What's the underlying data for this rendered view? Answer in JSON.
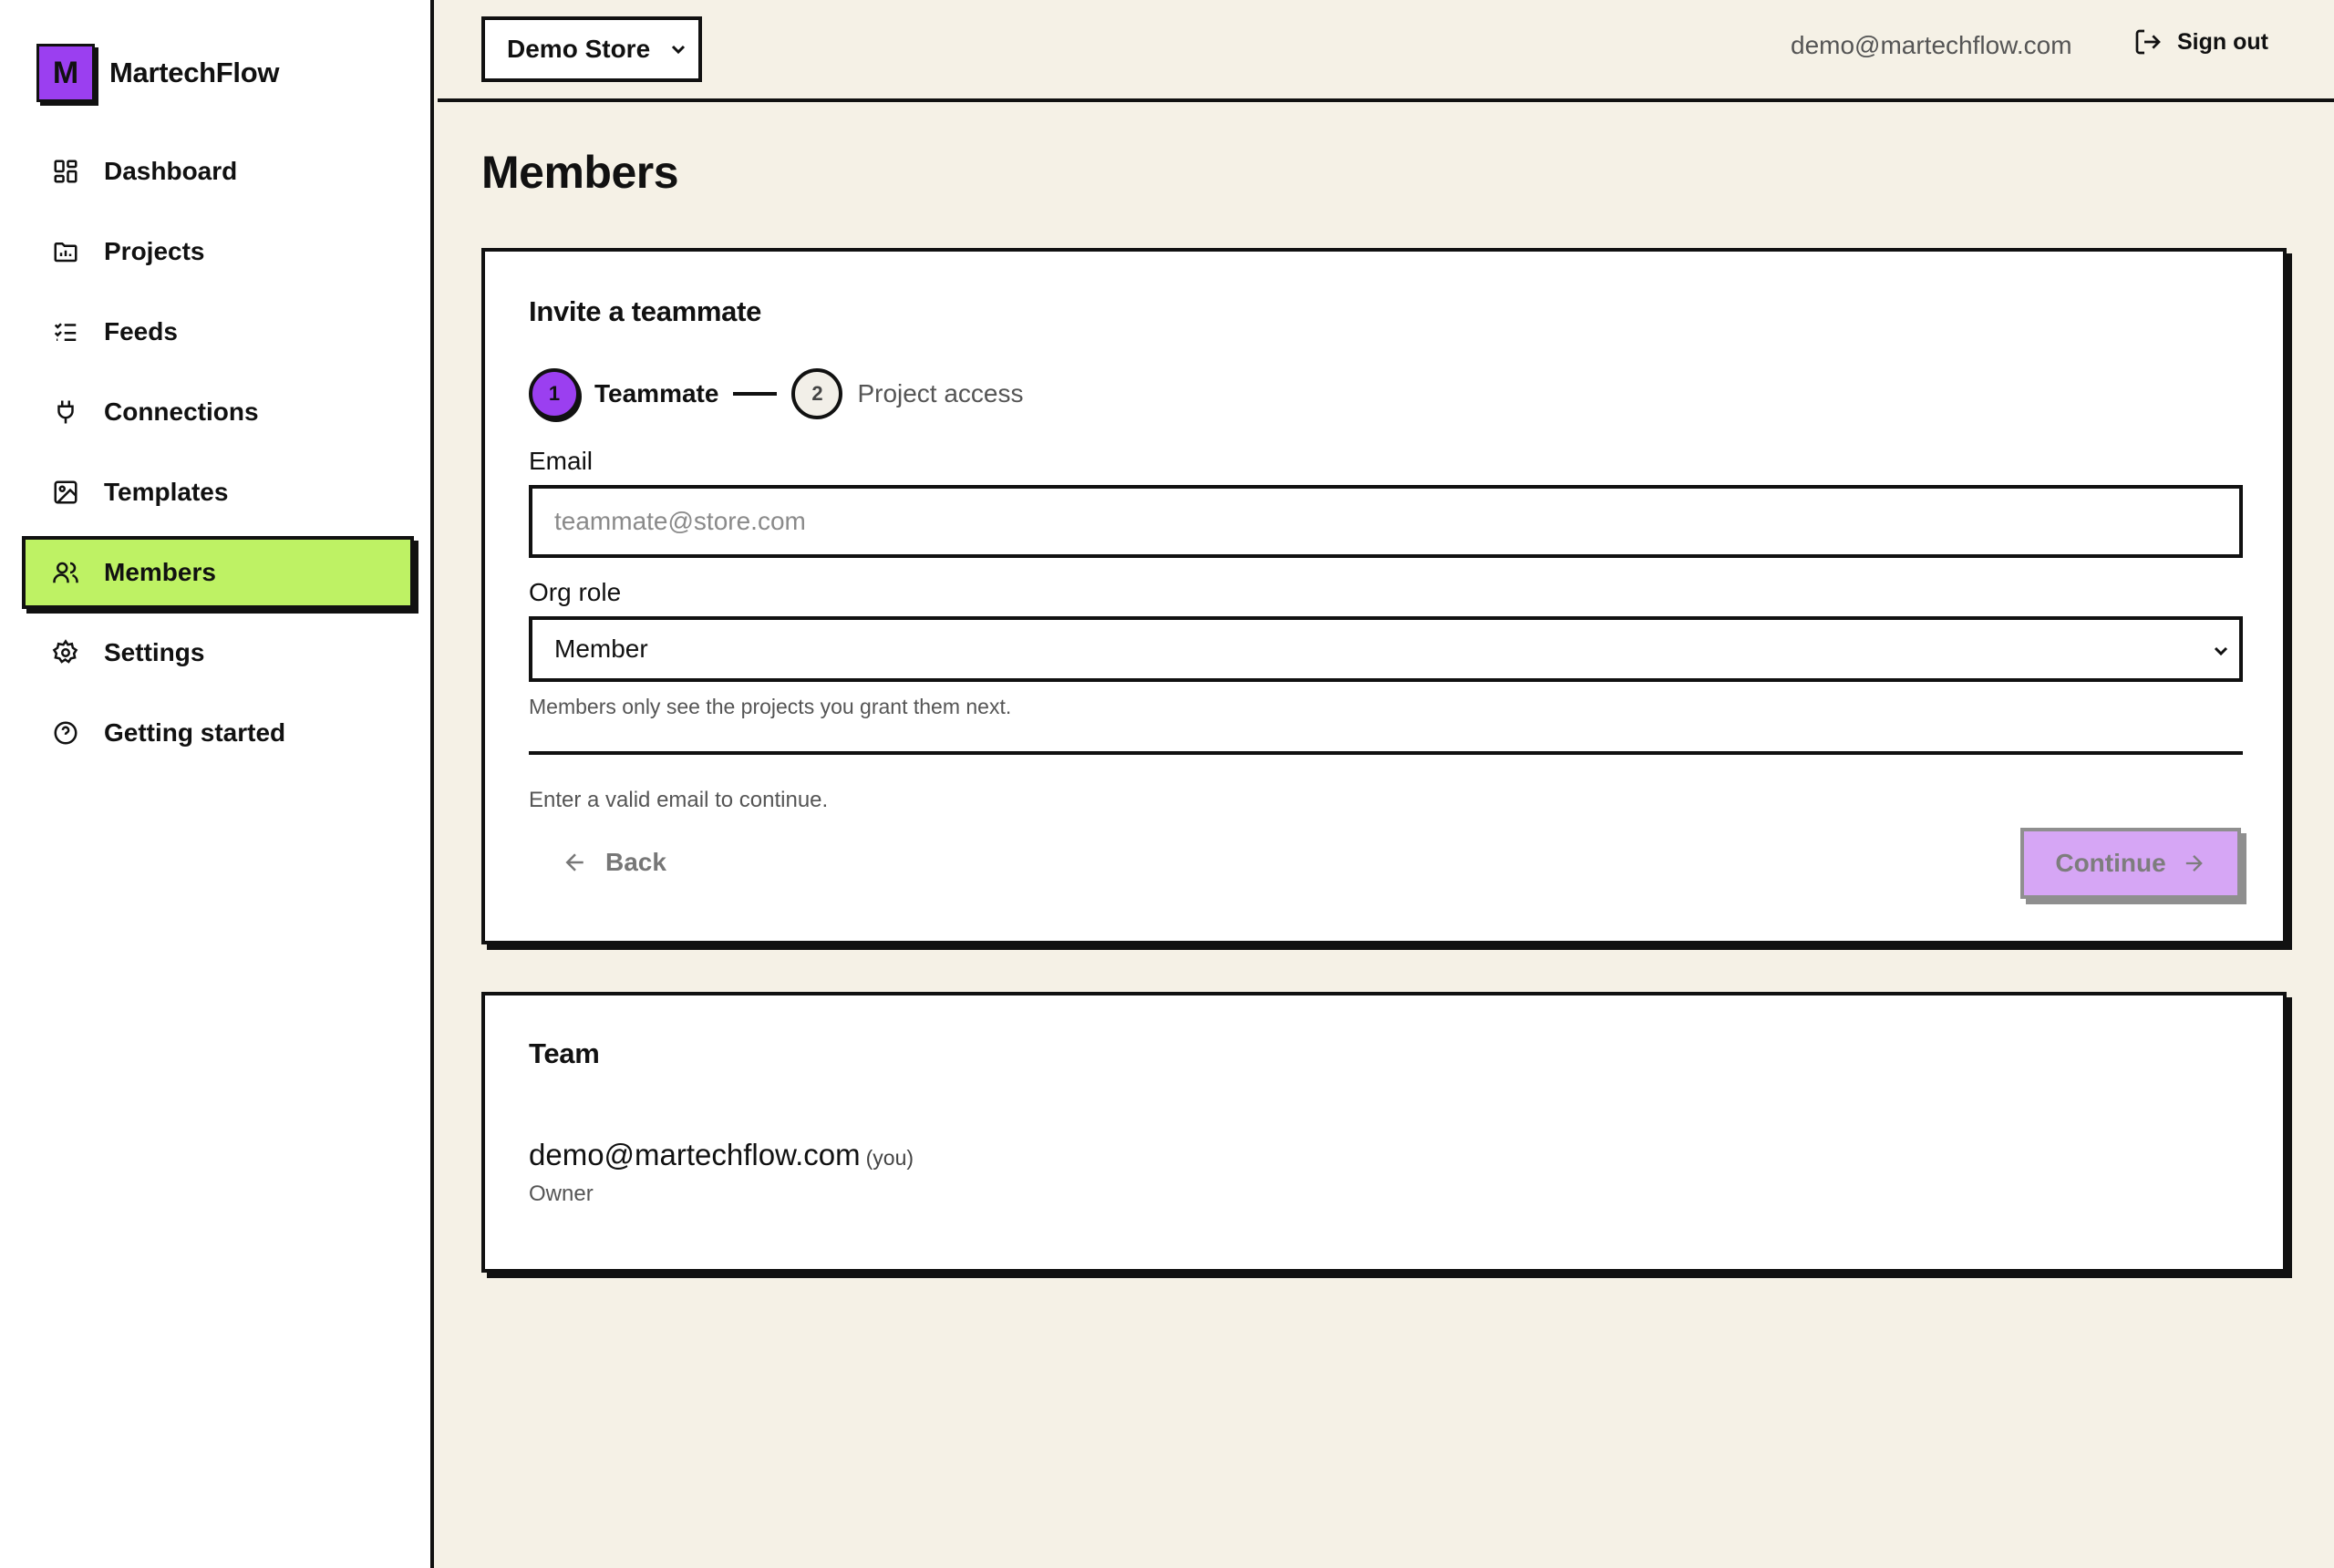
{
  "brand": {
    "logo_letter": "M",
    "name": "MartechFlow",
    "logo_color": "#9b3ff0"
  },
  "sidebar": {
    "items": [
      {
        "label": "Dashboard",
        "icon": "dashboard-icon"
      },
      {
        "label": "Projects",
        "icon": "folder-chart-icon"
      },
      {
        "label": "Feeds",
        "icon": "checklist-icon"
      },
      {
        "label": "Connections",
        "icon": "plug-icon"
      },
      {
        "label": "Templates",
        "icon": "image-icon"
      },
      {
        "label": "Members",
        "icon": "users-icon",
        "active": true
      },
      {
        "label": "Settings",
        "icon": "gear-icon"
      },
      {
        "label": "Getting started",
        "icon": "help-circle-icon"
      }
    ],
    "active_color": "#bef264"
  },
  "header": {
    "store": "Demo Store",
    "user_email": "demo@martechflow.com",
    "sign_out": "Sign out"
  },
  "page": {
    "title": "Members"
  },
  "invite": {
    "title": "Invite a teammate",
    "steps": [
      {
        "number": "1",
        "label": "Teammate",
        "state": "active"
      },
      {
        "number": "2",
        "label": "Project access",
        "state": "pending"
      }
    ],
    "email_label": "Email",
    "email_placeholder": "teammate@store.com",
    "email_value": "",
    "role_label": "Org role",
    "role_value": "Member",
    "role_help": "Members only see the projects you grant them next.",
    "validation": "Enter a valid email to continue.",
    "back_label": "Back",
    "continue_label": "Continue"
  },
  "team": {
    "title": "Team",
    "members": [
      {
        "email": "demo@martechflow.com",
        "you": "(you)",
        "role": "Owner"
      }
    ]
  }
}
